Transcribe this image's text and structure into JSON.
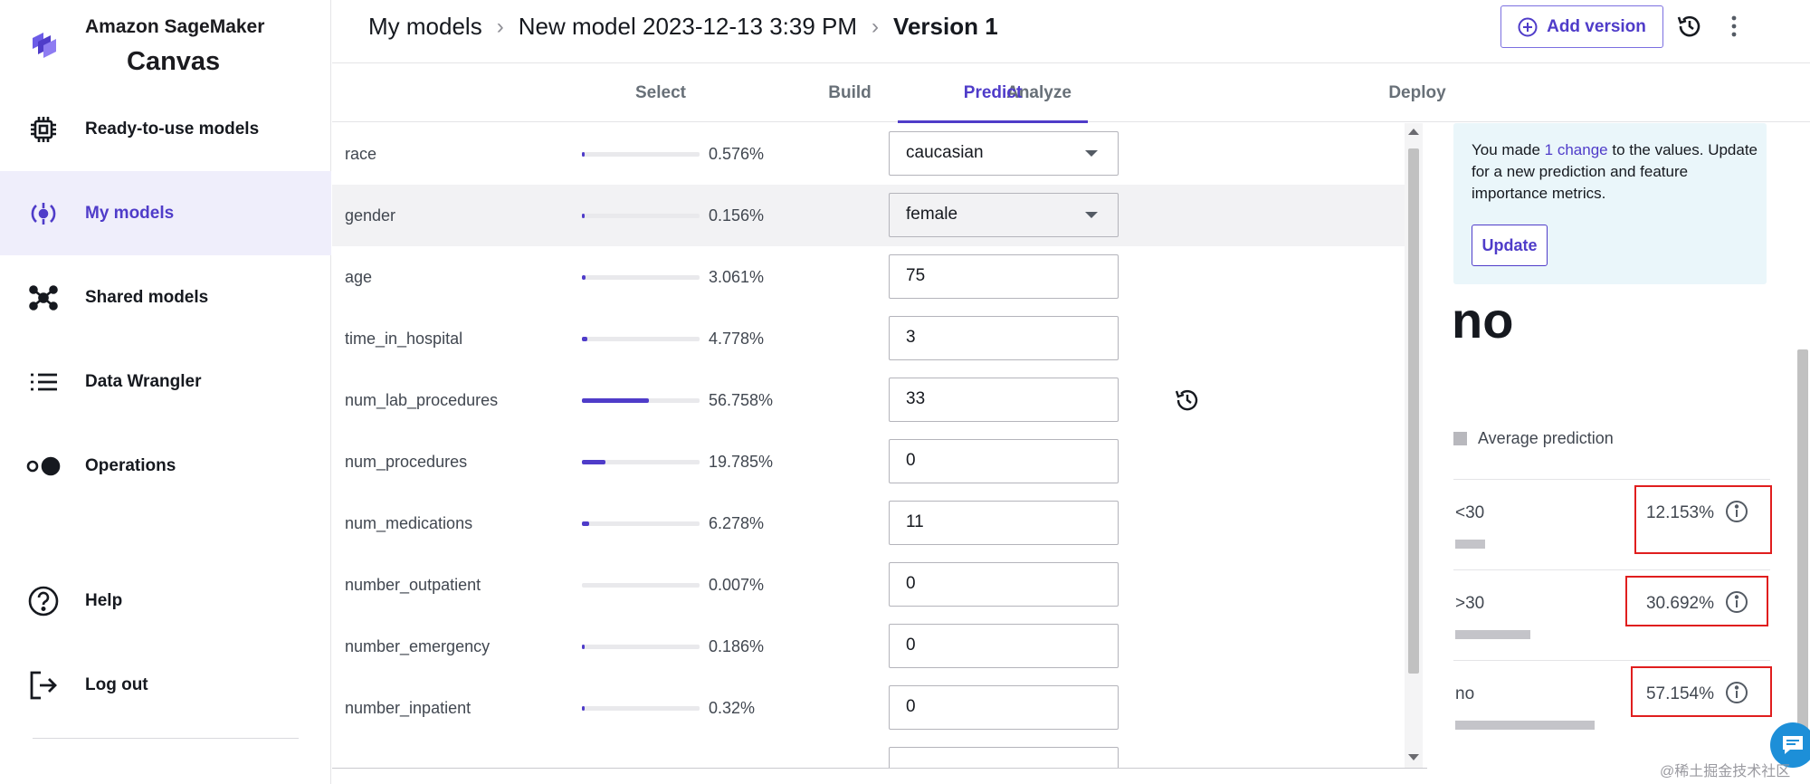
{
  "brand": {
    "subtitle": "Amazon SageMaker",
    "title": "Canvas"
  },
  "sidebar": {
    "items": [
      {
        "label": "Ready-to-use models",
        "icon": "chip-icon",
        "active": false
      },
      {
        "label": "My models",
        "icon": "models-icon",
        "active": true
      },
      {
        "label": "Shared models",
        "icon": "network-icon",
        "active": false
      },
      {
        "label": "Data Wrangler",
        "icon": "list-icon",
        "active": false
      },
      {
        "label": "Operations",
        "icon": "toggle-icon",
        "active": false
      },
      {
        "label": "Help",
        "icon": "help-icon",
        "active": false
      },
      {
        "label": "Log out",
        "icon": "logout-icon",
        "active": false
      }
    ]
  },
  "header": {
    "breadcrumb": [
      "My models",
      "New model 2023-12-13 3:39 PM",
      "Version 1"
    ],
    "add_version_label": "Add version"
  },
  "tabs": [
    "Select",
    "Build",
    "Analyze",
    "Predict",
    "Deploy"
  ],
  "active_tab": "Predict",
  "features": [
    {
      "name": "race",
      "importance": "0.576%",
      "fraction": 0.00576,
      "value": "caucasian",
      "type": "select"
    },
    {
      "name": "gender",
      "importance": "0.156%",
      "fraction": 0.00156,
      "value": "female",
      "type": "select"
    },
    {
      "name": "age",
      "importance": "3.061%",
      "fraction": 0.03061,
      "value": "75",
      "type": "input"
    },
    {
      "name": "time_in_hospital",
      "importance": "4.778%",
      "fraction": 0.04778,
      "value": "3",
      "type": "input"
    },
    {
      "name": "num_lab_procedures",
      "importance": "56.758%",
      "fraction": 0.56758,
      "value": "33",
      "type": "input"
    },
    {
      "name": "num_procedures",
      "importance": "19.785%",
      "fraction": 0.19785,
      "value": "0",
      "type": "input"
    },
    {
      "name": "num_medications",
      "importance": "6.278%",
      "fraction": 0.06278,
      "value": "11",
      "type": "input"
    },
    {
      "name": "number_outpatient",
      "importance": "0.007%",
      "fraction": 7e-05,
      "value": "0",
      "type": "input"
    },
    {
      "name": "number_emergency",
      "importance": "0.186%",
      "fraction": 0.00186,
      "value": "0",
      "type": "input"
    },
    {
      "name": "number_inpatient",
      "importance": "0.32%",
      "fraction": 0.0032,
      "value": "0",
      "type": "input"
    }
  ],
  "notice": {
    "prefix": "You made ",
    "link": "1 change",
    "suffix": " to the values. Update for a new prediction and feature importance metrics.",
    "update_label": "Update"
  },
  "prediction": {
    "label": "no",
    "legend": "Average prediction",
    "classes": [
      {
        "label": "<30",
        "pct": "12.153%",
        "fraction": 0.12153
      },
      {
        "label": ">30",
        "pct": "30.692%",
        "fraction": 0.30692
      },
      {
        "label": "no",
        "pct": "57.154%",
        "fraction": 0.57154
      }
    ]
  },
  "watermark": "@稀土掘金技术社区",
  "colors": {
    "accent": "#4f3cc9",
    "highlight": "#e01e1e",
    "notice_bg": "#eaf6fa"
  }
}
